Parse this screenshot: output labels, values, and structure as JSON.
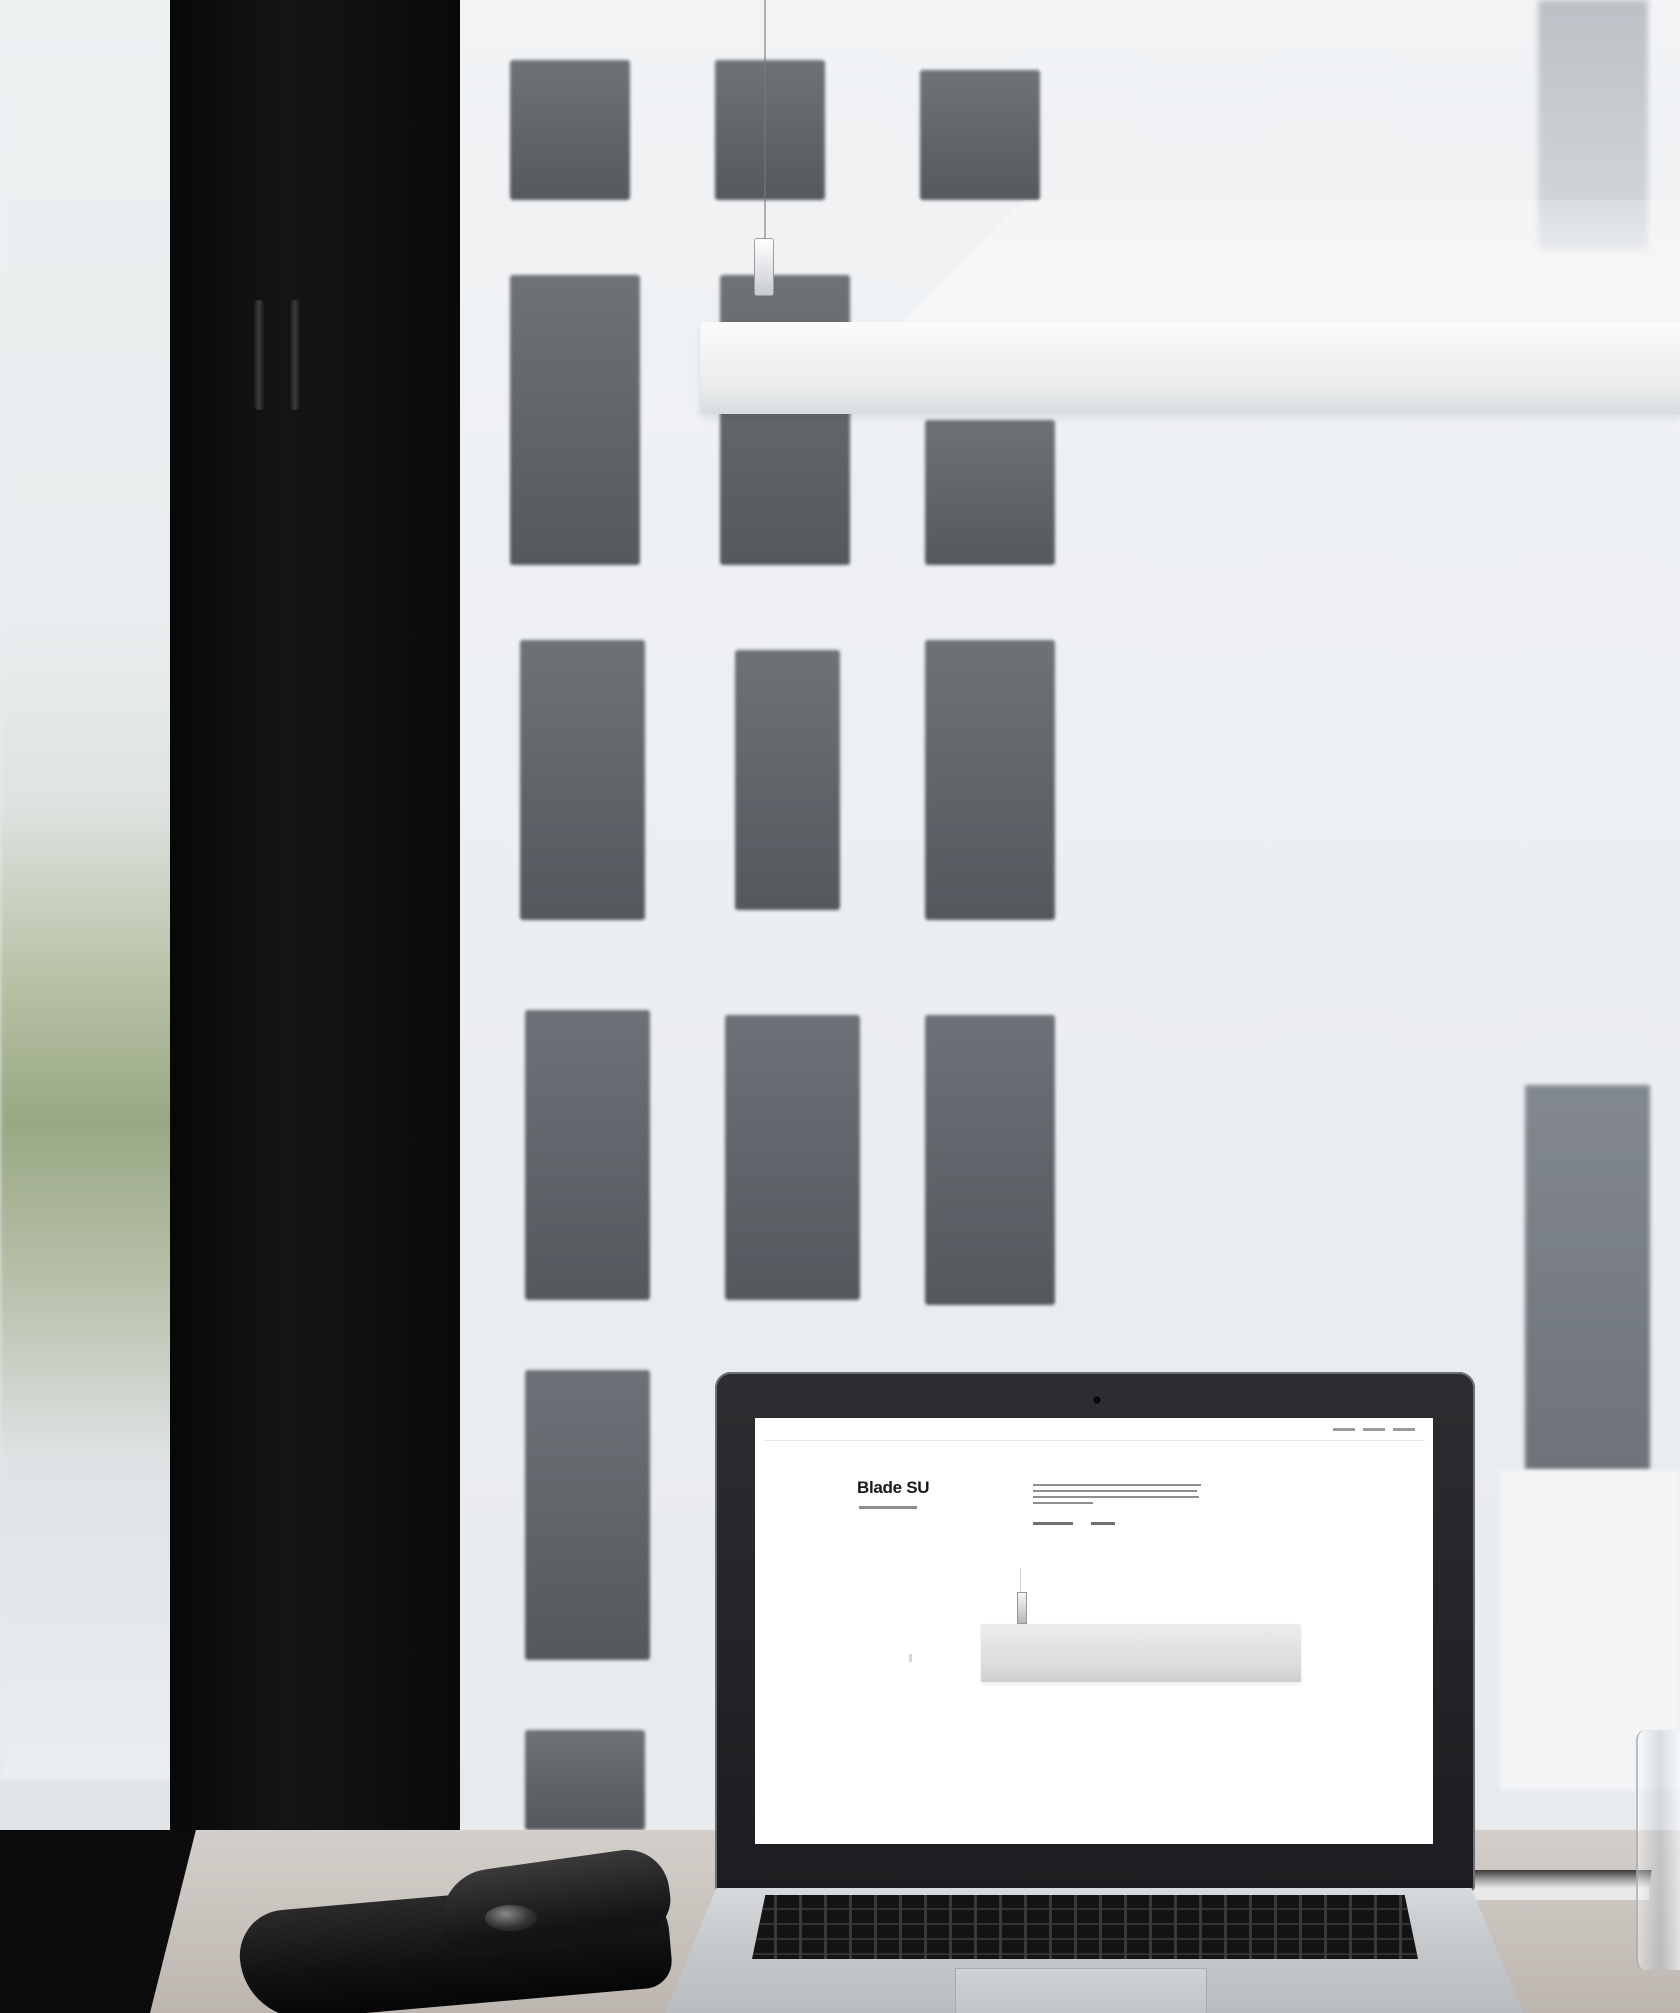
{
  "screen": {
    "product_title": "Blade SU"
  }
}
